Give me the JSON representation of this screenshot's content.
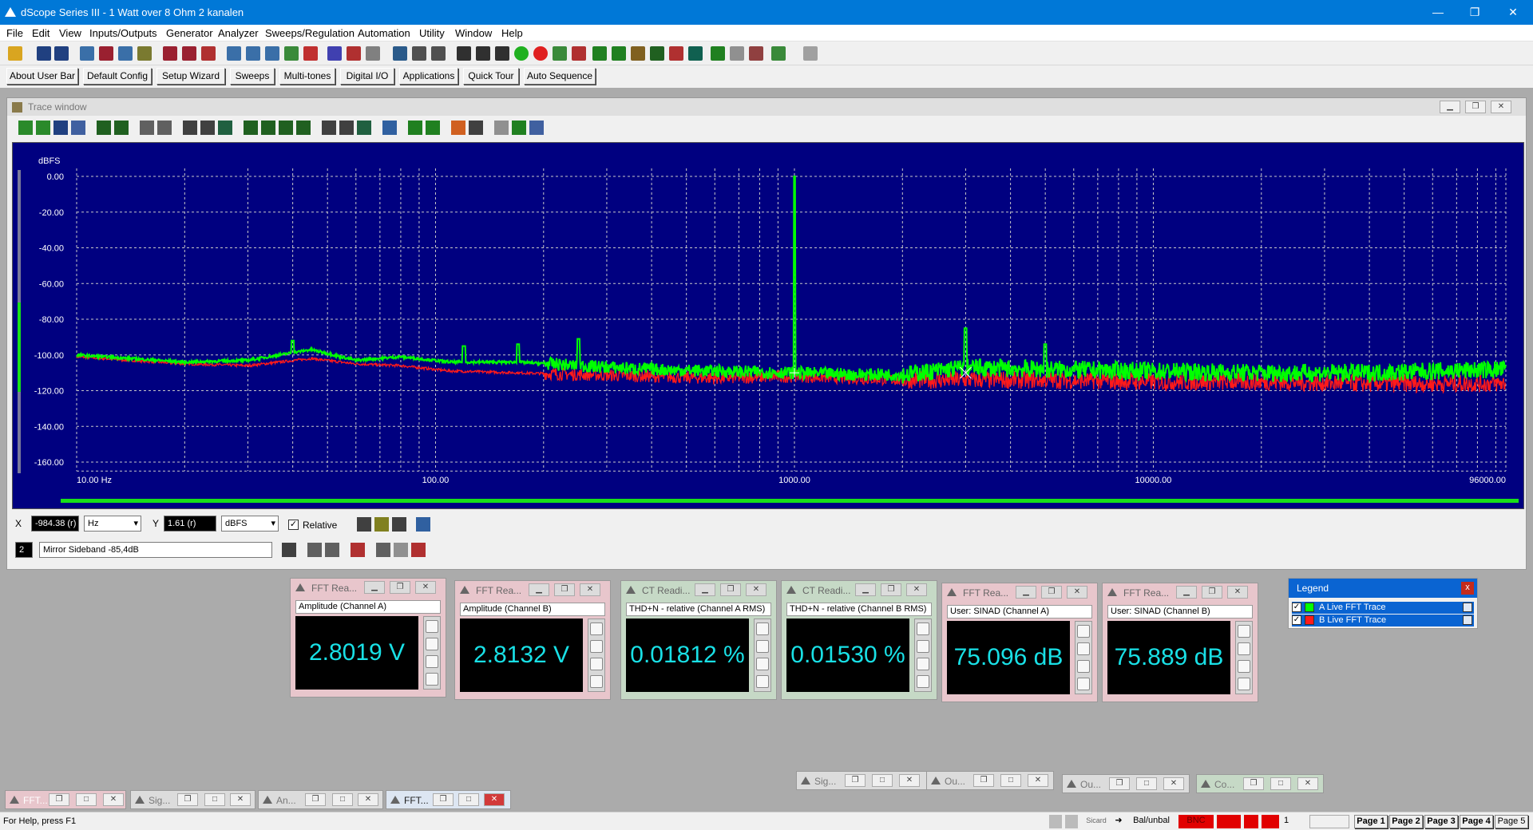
{
  "window": {
    "title": "dScope Series III - 1 Watt over 8 Ohm 2 kanalen",
    "minimize": "—",
    "maximize": "❐",
    "close": "✕"
  },
  "menu": [
    "File",
    "Edit",
    "View",
    "Inputs/Outputs",
    "Generator",
    "Analyzer",
    "Sweeps/Regulation",
    "Automation",
    "Utility",
    "Window",
    "Help"
  ],
  "userbar": [
    "About User Bar",
    "Default Config",
    "Setup Wizard",
    "Sweeps",
    "Multi-tones",
    "Digital I/O",
    "Applications",
    "Quick Tour",
    "Auto Sequence"
  ],
  "trace_window": {
    "title": "Trace window",
    "cursor": {
      "x_label": "X",
      "x_value": "-984.38 (r)",
      "x_unit": "Hz",
      "y_label": "Y",
      "y_value": "1.61 (r)",
      "y_unit": "dBFS",
      "relative_label": "Relative",
      "relative_checked": true
    },
    "marker": {
      "number": "2",
      "text": "Mirror Sideband -85,4dB"
    }
  },
  "chart_data": {
    "type": "line",
    "ylabel": "dBFS",
    "x_scale": "log",
    "xlim": [
      10,
      96000
    ],
    "ylim": [
      -165,
      2
    ],
    "y_ticks": [
      0,
      -20,
      -40,
      -60,
      -80,
      -100,
      -120,
      -140,
      -160
    ],
    "y_tick_labels": [
      "0.00",
      "-20.00",
      "-40.00",
      "-60.00",
      "-80.00",
      "-100.00",
      "-120.00",
      "-140.00",
      "-160.00"
    ],
    "x_ticks": [
      10,
      100,
      1000,
      10000,
      96000
    ],
    "x_tick_labels": [
      "10.00 Hz",
      "100.00",
      "1000.00",
      "10000.00",
      "96000.00"
    ],
    "grid": true,
    "background": "#000080",
    "series": [
      {
        "name": "Live FFT Trace",
        "channel": "A",
        "color": "#00ff00",
        "points": [
          [
            10,
            -100
          ],
          [
            20,
            -104
          ],
          [
            30,
            -103
          ],
          [
            45,
            -97
          ],
          [
            60,
            -103
          ],
          [
            80,
            -101
          ],
          [
            110,
            -104
          ],
          [
            170,
            -104
          ],
          [
            250,
            -106
          ],
          [
            400,
            -108
          ],
          [
            600,
            -109
          ],
          [
            990,
            -110
          ],
          [
            1000,
            0
          ],
          [
            1010,
            -110
          ],
          [
            1500,
            -111
          ],
          [
            2000,
            -111
          ],
          [
            3000,
            -107
          ],
          [
            5000,
            -108
          ],
          [
            10000,
            -109
          ],
          [
            20000,
            -110
          ],
          [
            40000,
            -110
          ],
          [
            96000,
            -108
          ]
        ],
        "peaks": [
          [
            40,
            -92
          ],
          [
            120,
            -95
          ],
          [
            170,
            -94
          ],
          [
            250,
            -91
          ],
          [
            1000,
            0
          ],
          [
            3000,
            -85
          ],
          [
            5000,
            -94
          ]
        ]
      },
      {
        "name": "Live FFT Trace",
        "channel": "B",
        "color": "#ff1a1a",
        "points": [
          [
            10,
            -101
          ],
          [
            20,
            -105
          ],
          [
            30,
            -106
          ],
          [
            45,
            -102
          ],
          [
            60,
            -105
          ],
          [
            80,
            -106
          ],
          [
            110,
            -109
          ],
          [
            170,
            -110
          ],
          [
            250,
            -111
          ],
          [
            400,
            -112
          ],
          [
            600,
            -113
          ],
          [
            990,
            -112
          ],
          [
            1000,
            0
          ],
          [
            1010,
            -112
          ],
          [
            1500,
            -113
          ],
          [
            2000,
            -114
          ],
          [
            3000,
            -114
          ],
          [
            5000,
            -114
          ],
          [
            10000,
            -115
          ],
          [
            20000,
            -115
          ],
          [
            40000,
            -116
          ],
          [
            96000,
            -116
          ]
        ],
        "peaks": []
      }
    ],
    "cursor_x": 1000
  },
  "readings": [
    {
      "title": "FFT Rea...",
      "label": "Amplitude (Channel A)",
      "value": "2.8019 V"
    },
    {
      "title": "FFT Rea...",
      "label": "Amplitude (Channel B)",
      "value": "2.8132 V"
    },
    {
      "title": "CT Readi...",
      "label": "THD+N - relative (Channel A RMS)",
      "value": "0.01812 %"
    },
    {
      "title": "CT Readi...",
      "label": "THD+N - relative (Channel B RMS)",
      "value": "0.01530 %"
    },
    {
      "title": "FFT Rea...",
      "label": "User: SINAD (Channel A)",
      "value": "75.096 dB"
    },
    {
      "title": "FFT Rea...",
      "label": "User: SINAD (Channel B)",
      "value": "75.889 dB"
    }
  ],
  "legend": {
    "title": "Legend",
    "close": "x",
    "items": [
      {
        "label": "A  Live FFT Trace",
        "color": "#00ff00",
        "checked": true
      },
      {
        "label": "B  Live FFT Trace",
        "color": "#ff1a1a",
        "checked": true
      }
    ]
  },
  "minimized_windows": [
    {
      "title": "Sig...",
      "color": "#dcdcdc"
    },
    {
      "title": "Ou...",
      "color": "#dcdcdc"
    },
    {
      "title": "Ou...",
      "color": "#dcdcdc"
    },
    {
      "title": "Co...",
      "color": "#c6d9c6"
    }
  ],
  "taskbar_windows": [
    {
      "title": "FFT...",
      "color": "#e8c6cc"
    },
    {
      "title": "Sig...",
      "color": "#dcdcdc"
    },
    {
      "title": "An...",
      "color": "#dcdcdc"
    },
    {
      "title": "FFT...",
      "color": "#e8c6cc"
    }
  ],
  "status": {
    "help": "For Help, press F1",
    "sicard": "Sicard",
    "bal": "Bal/unbal",
    "bnc": "BNC",
    "one": "1",
    "pages": [
      "Page 1",
      "Page 2",
      "Page 3",
      "Page 4",
      "Page 5"
    ]
  }
}
